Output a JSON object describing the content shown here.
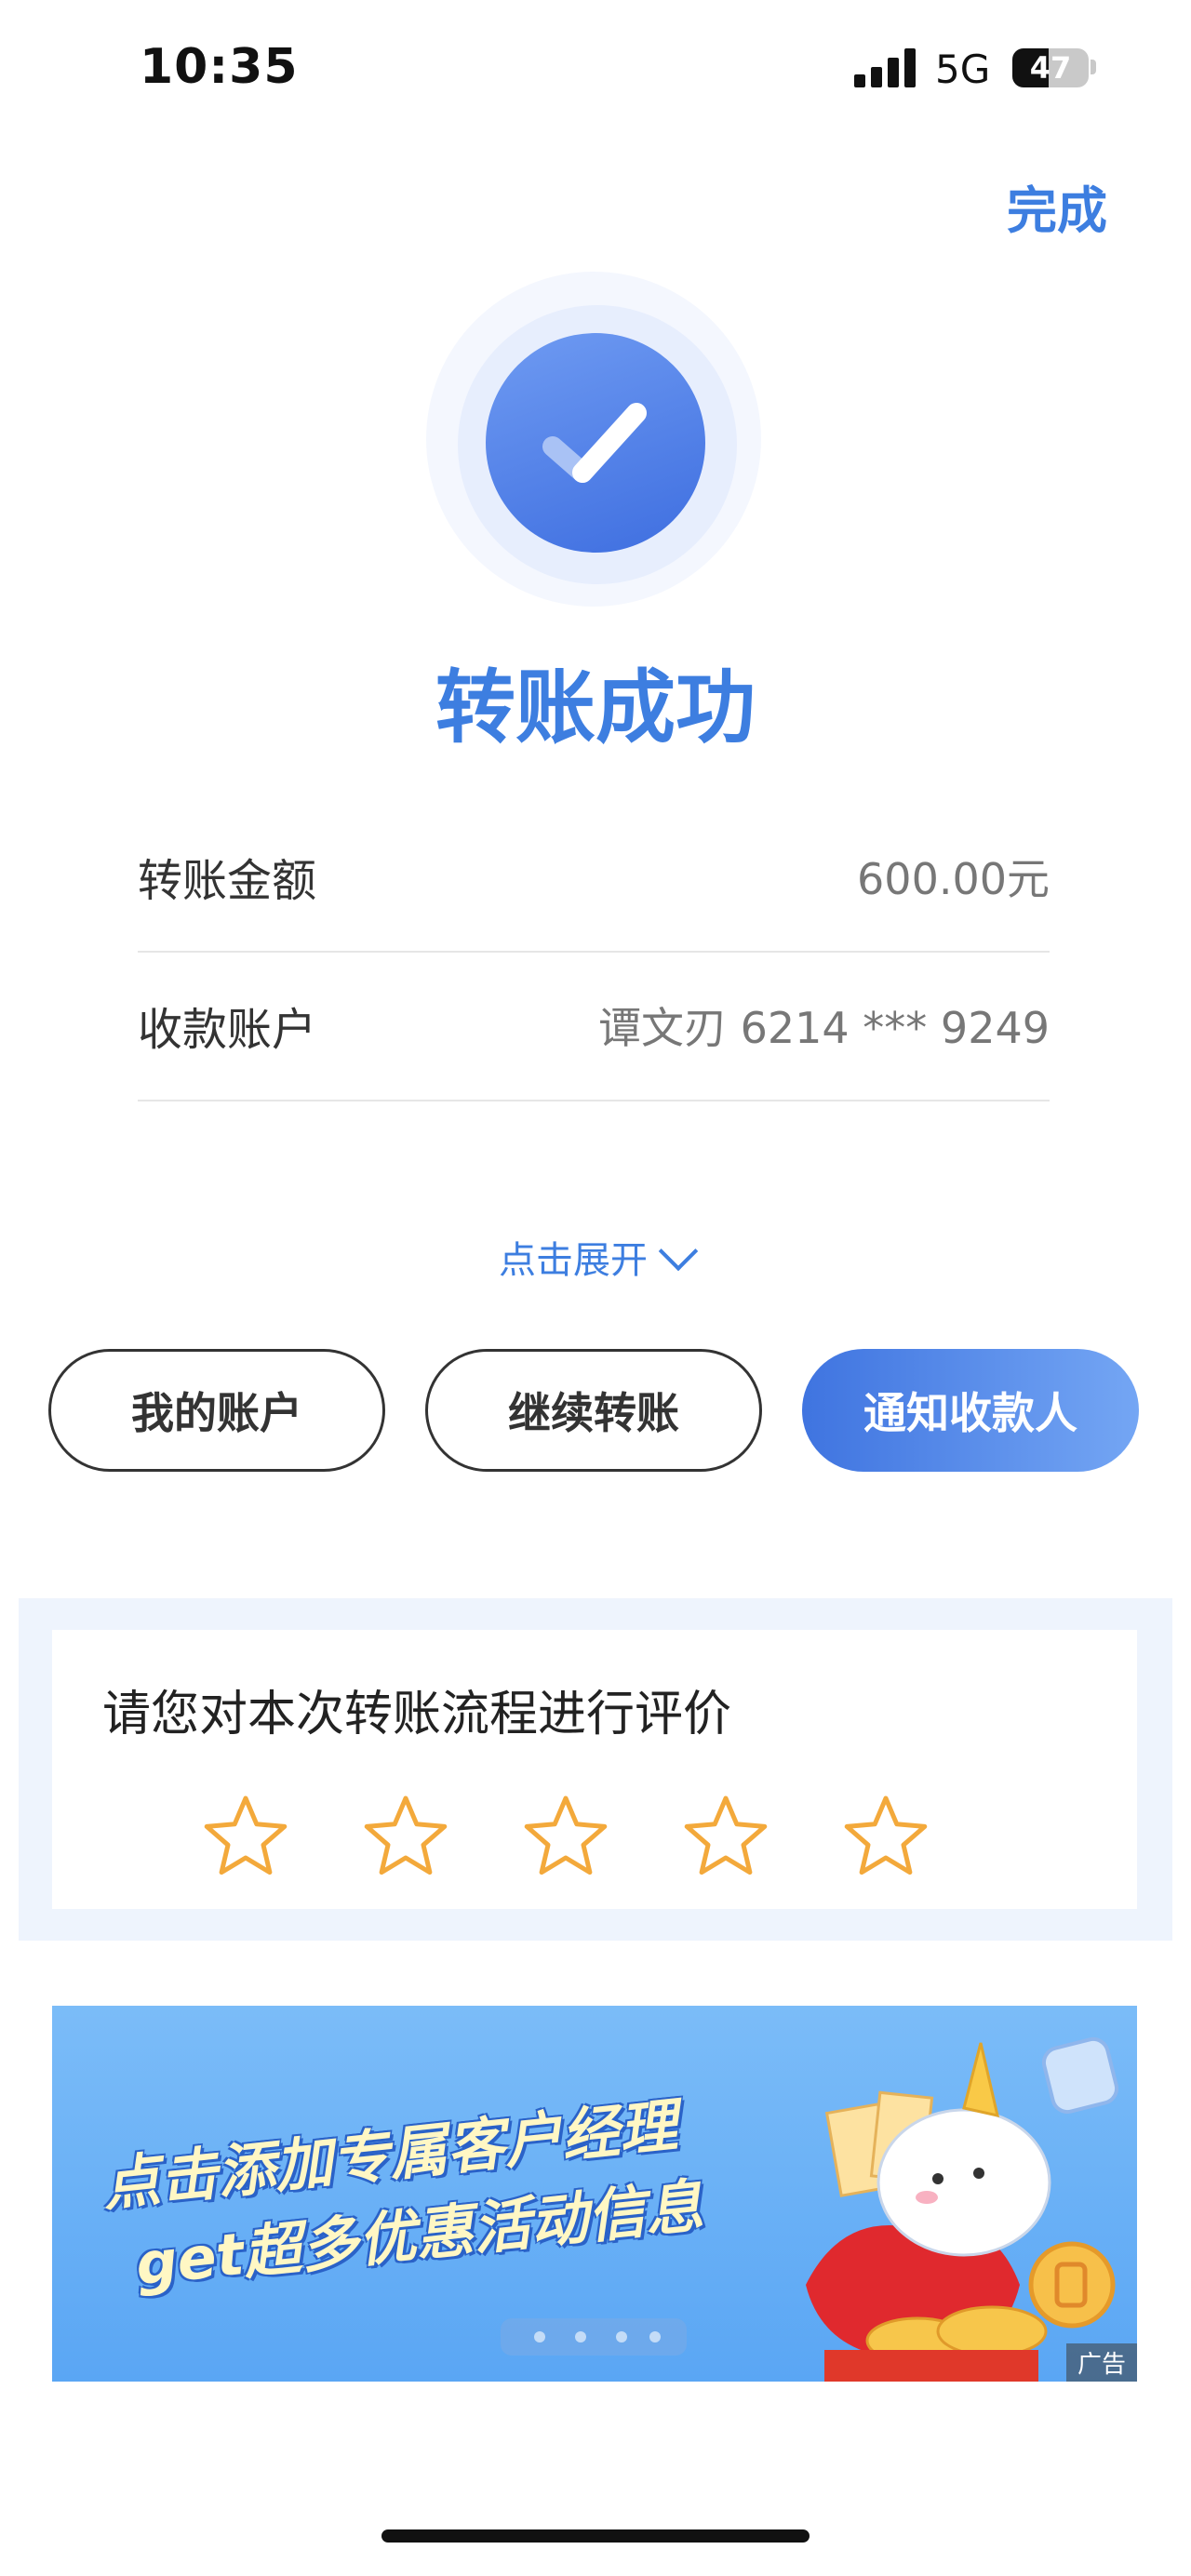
{
  "status_bar": {
    "time": "10:35",
    "network": "5G",
    "battery": "47"
  },
  "header": {
    "done_label": "完成"
  },
  "result": {
    "title": "转账成功"
  },
  "details": [
    {
      "label": "转账金额",
      "value": "600.00元"
    },
    {
      "label": "收款账户",
      "value": "谭文刃 6214 *** 9249"
    }
  ],
  "expand_label": "点击展开",
  "actions": {
    "my_account": "我的账户",
    "continue_transfer": "继续转账",
    "notify_payee": "通知收款人"
  },
  "rating": {
    "title": "请您对本次转账流程进行评价",
    "stars": 5,
    "star_color": "#f3a93b"
  },
  "banner": {
    "line1": "点击添加专属客户经理",
    "line2": "get超多优惠活动信息",
    "ad_tag": "广告"
  },
  "colors": {
    "accent": "#3d7ee0",
    "banner_bg": "#6eb2f7"
  }
}
